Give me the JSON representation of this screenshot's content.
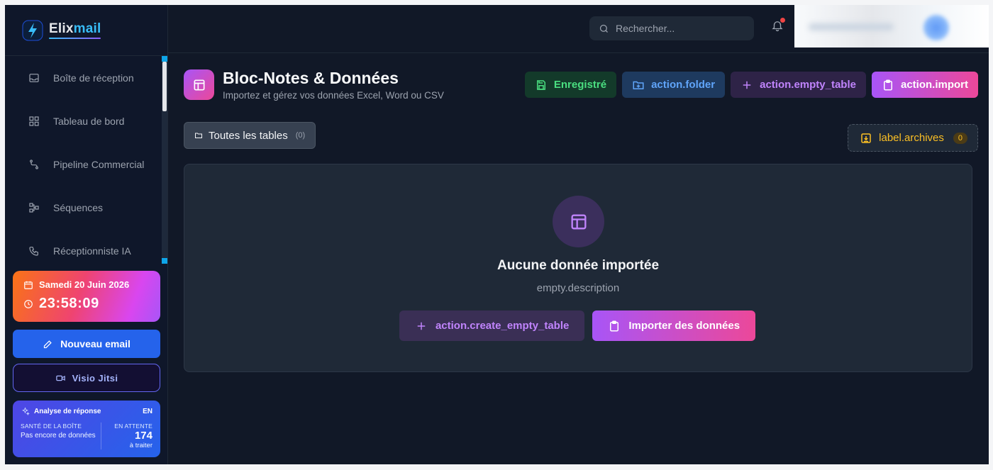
{
  "brand": {
    "name_part1": "Elix",
    "name_part2": "mail"
  },
  "sidebar": {
    "items": [
      {
        "label": "Boîte de réception",
        "icon": "inbox-icon"
      },
      {
        "label": "Tableau de bord",
        "icon": "dashboard-icon"
      },
      {
        "label": "Pipeline Commercial",
        "icon": "route-icon"
      },
      {
        "label": "Séquences",
        "icon": "workflow-icon"
      },
      {
        "label": "Réceptionniste IA",
        "icon": "phone-icon"
      }
    ],
    "datetime": {
      "date": "Samedi 20 Juin 2026",
      "time": "23:58:09"
    },
    "new_email_label": "Nouveau email",
    "visio_label": "Visio Jitsi",
    "analysis": {
      "title": "Analyse de réponse",
      "lang": "EN",
      "health_caption": "SANTÉ DE LA BOÎTE",
      "health_value": "Pas encore de données",
      "pending_caption": "EN ATTENTE",
      "pending_count": "174",
      "pending_suffix": "à traiter"
    }
  },
  "header": {
    "search_placeholder": "Rechercher...",
    "notifications_unread": true
  },
  "main": {
    "title": "Bloc-Notes & Données",
    "subtitle": "Importez et gérez vos données Excel, Word ou CSV",
    "actions": {
      "saved": "Enregistré",
      "folder": "action.folder",
      "empty_table": "action.empty_table",
      "import": "action.import"
    },
    "tab_all": {
      "label": "Toutes les tables",
      "count": "(0)"
    },
    "archives": {
      "label": "label.archives",
      "count": "0"
    },
    "empty": {
      "title": "Aucune donnée importée",
      "description": "empty.description",
      "create_label": "action.create_empty_table",
      "import_label": "Importer des données"
    }
  },
  "colors": {
    "accent_purple": "#a855f7",
    "accent_pink": "#ec4899",
    "primary_blue": "#2563eb",
    "success_green": "#4ade80",
    "warning_amber": "#fbbf24",
    "background": "#111827"
  }
}
